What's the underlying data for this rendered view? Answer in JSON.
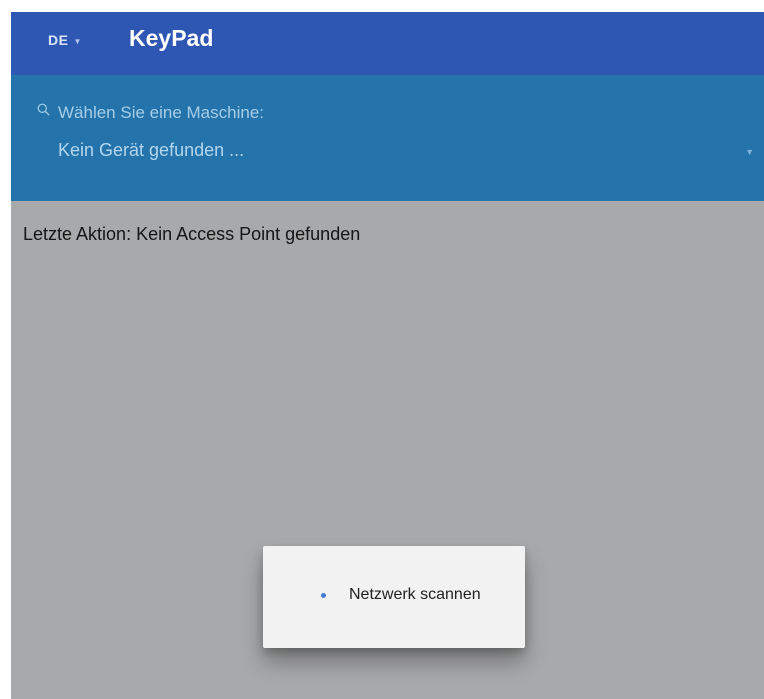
{
  "header": {
    "language": "DE",
    "title": "KeyPad",
    "language_caret_icon": "caret-down-icon"
  },
  "machine_selector": {
    "icon": "search-icon",
    "label": "Wählen Sie eine Maschine:",
    "value": "Kein Gerät gefunden ...",
    "caret_icon": "caret-down-icon"
  },
  "status": {
    "text": "Letzte Aktion: Kein Access Point gefunden"
  },
  "progress_dialog": {
    "text": "Netzwerk scannen",
    "indicator": "spinner"
  },
  "colors": {
    "appbar": "#2e57b4",
    "panel": "#2474ab",
    "overlay": "#a8a9aa",
    "dialog": "#f2f2f2",
    "spinner": "#3f7ed6"
  }
}
